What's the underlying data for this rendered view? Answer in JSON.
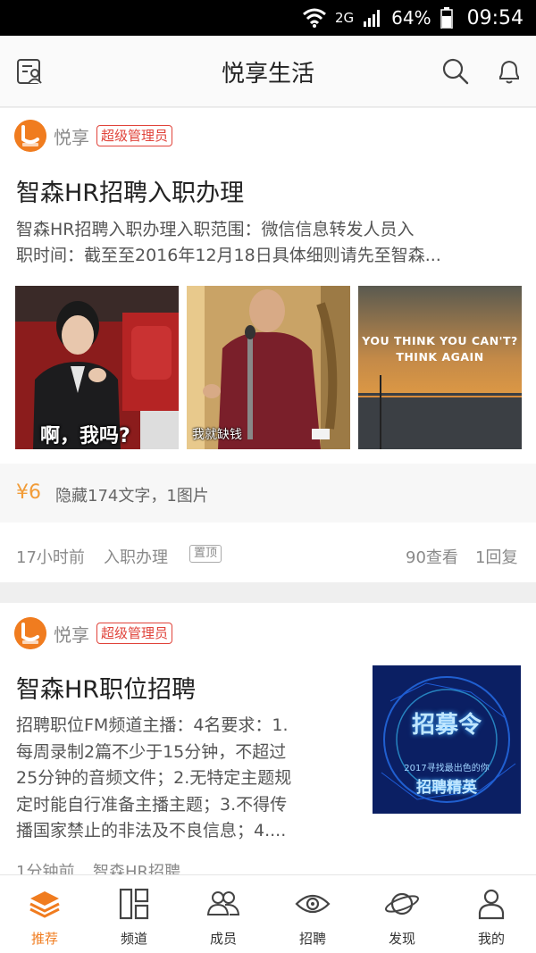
{
  "status_bar": {
    "network": "2G",
    "battery": "64%",
    "time": "09:54"
  },
  "header": {
    "title": "悦享生活",
    "left_icon": "profile-card-icon",
    "search_icon": "search-icon",
    "bell_icon": "bell-icon"
  },
  "posts": [
    {
      "author": "悦享",
      "badge": "超级管理员",
      "title": "智森HR招聘入职办理",
      "summary_line1": "智森HR招聘入职办理入职范围：微信信息转发人员入",
      "summary_line2": "职时间：截至至2016年12月18日具体细则请先至智森...",
      "images": [
        {
          "caption": "啊，我吗?"
        },
        {
          "caption": "我就缺钱"
        },
        {
          "line1": "YOU THINK YOU CAN'T?",
          "line2": "THINK AGAIN"
        }
      ],
      "reward_amount": "¥6",
      "reward_text": "隐藏174文字，1图片",
      "time": "17小时前",
      "category": "入职办理",
      "pin": "置顶",
      "views": "90查看",
      "replies": "1回复"
    },
    {
      "author": "悦享",
      "badge": "超级管理员",
      "title": "智森HR职位招聘",
      "summary_lines": [
        "招聘职位FM频道主播：4名要求：1.",
        "每周录制2篇不少于15分钟，不超过",
        "25分钟的音频文件；2.无特定主题规",
        "定时能自行准备主播主题；3.不得传",
        "播国家禁止的非法及不良信息；4...."
      ],
      "thumb_line1": "招募令",
      "thumb_line2": "2017寻找最出色的你",
      "thumb_line3": "招聘精英",
      "time": "1分钟前",
      "category": "智森HR招聘"
    }
  ],
  "tabs": [
    {
      "label": "推荐",
      "icon": "layers-icon",
      "active": true
    },
    {
      "label": "频道",
      "icon": "grid-icon",
      "active": false
    },
    {
      "label": "成员",
      "icon": "users-icon",
      "active": false
    },
    {
      "label": "招聘",
      "icon": "eye-icon",
      "active": false
    },
    {
      "label": "发现",
      "icon": "planet-icon",
      "active": false
    },
    {
      "label": "我的",
      "icon": "person-icon",
      "active": false
    }
  ],
  "colors": {
    "accent": "#f07c1f",
    "badge": "#e0433a",
    "reward": "#f29c38"
  }
}
